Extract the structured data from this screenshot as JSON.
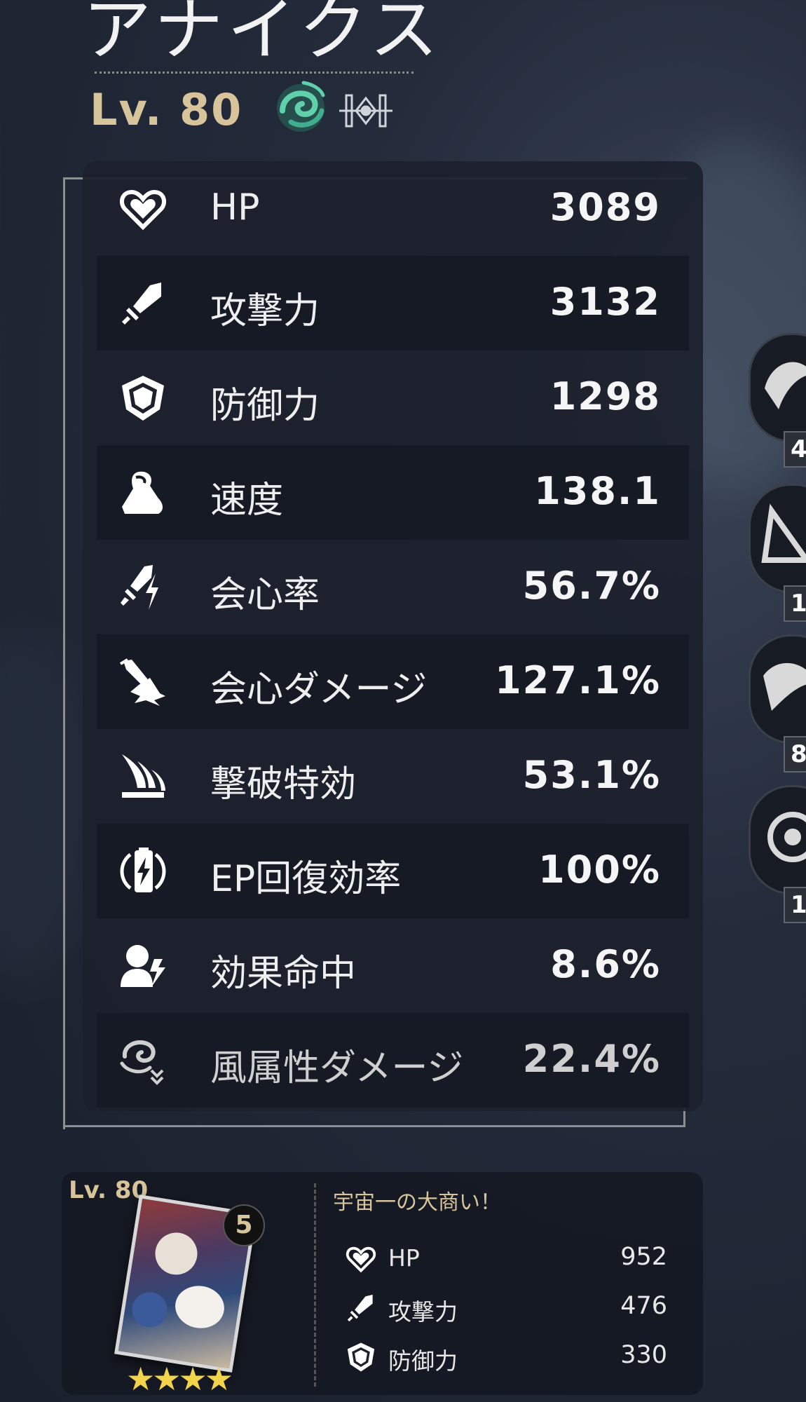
{
  "character": {
    "name": "アナイクス",
    "level": "Lv. 80",
    "element_icon": "wind-element-icon",
    "path_icon": "erudition-path-icon",
    "element_color": "#3fae8c"
  },
  "stats": [
    {
      "icon": "heart-icon",
      "label": "HP",
      "value": "3089"
    },
    {
      "icon": "sword-icon",
      "label": "攻撃力",
      "value": "3132"
    },
    {
      "icon": "shield-icon",
      "label": "防御力",
      "value": "1298"
    },
    {
      "icon": "boot-icon",
      "label": "速度",
      "value": "138.1"
    },
    {
      "icon": "crit-rate-icon",
      "label": "会心率",
      "value": "56.7%"
    },
    {
      "icon": "crit-damage-icon",
      "label": "会心ダメージ",
      "value": "127.1%"
    },
    {
      "icon": "break-effect-icon",
      "label": "撃破特効",
      "value": "53.1%"
    },
    {
      "icon": "energy-icon",
      "label": "EP回復効率",
      "value": "100%"
    },
    {
      "icon": "effect-hit-icon",
      "label": "効果命中",
      "value": "8.6%"
    },
    {
      "icon": "wind-damage-icon",
      "label": "風属性ダメージ",
      "value": "22.4%"
    }
  ],
  "side_avatars": [
    {
      "badge": "4"
    },
    {
      "badge": "1"
    },
    {
      "badge": "8"
    },
    {
      "badge": "1"
    }
  ],
  "light_cone": {
    "level": "Lv. 80",
    "superimposition": "5",
    "rarity_stars": "★★★★",
    "name": "宇宙一の大商い！",
    "stats": [
      {
        "icon": "heart-icon",
        "label": "HP",
        "value": "952"
      },
      {
        "icon": "sword-icon",
        "label": "攻撃力",
        "value": "476"
      },
      {
        "icon": "shield-icon",
        "label": "防御力",
        "value": "330"
      }
    ]
  }
}
